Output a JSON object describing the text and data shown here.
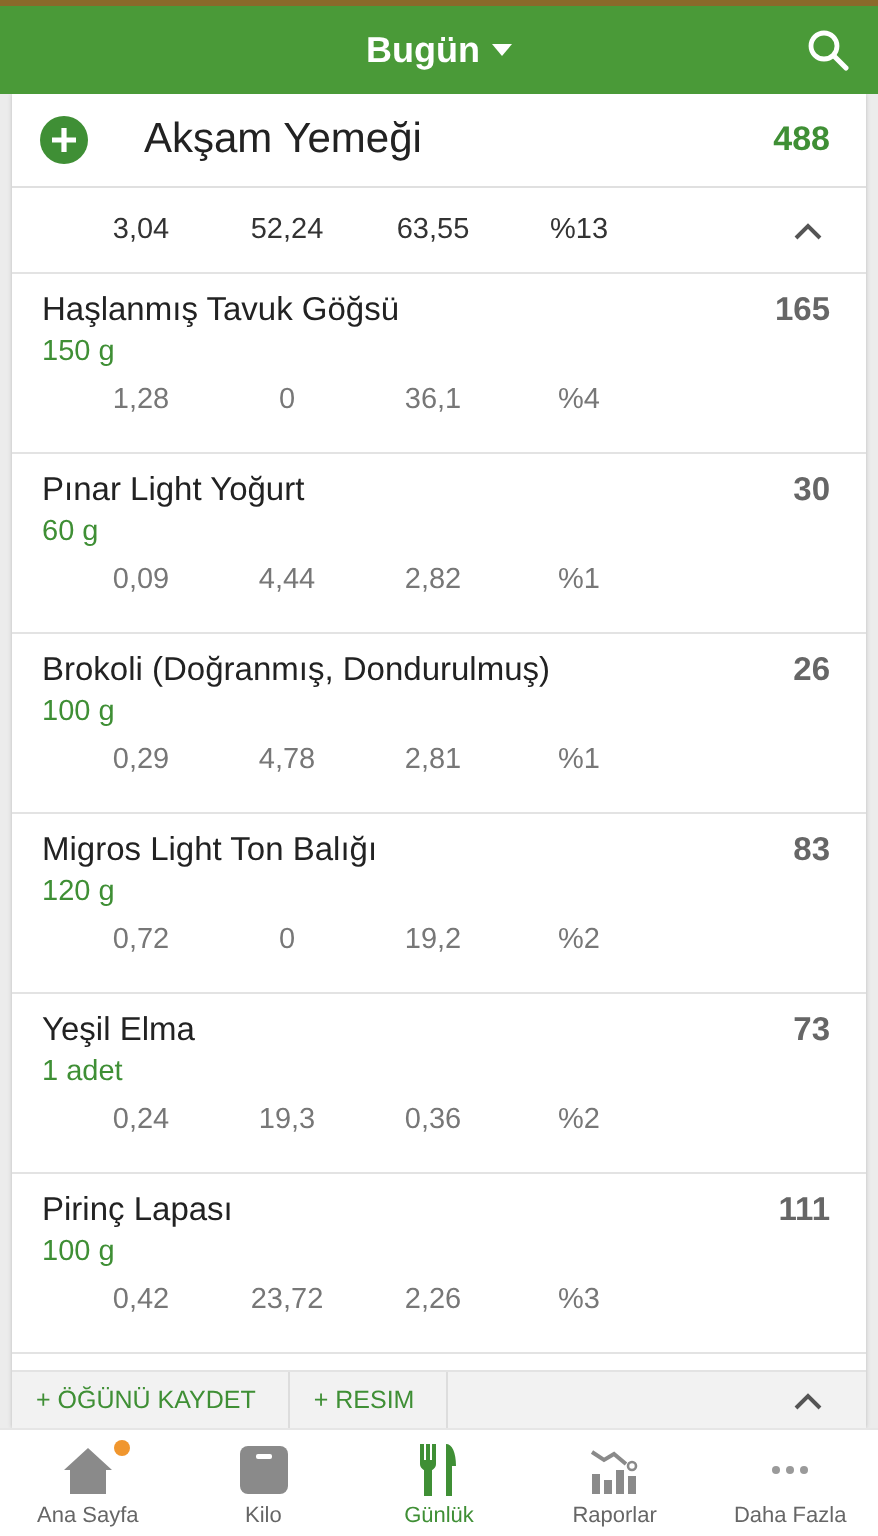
{
  "header": {
    "title": "Bugün"
  },
  "meal": {
    "name": "Akşam Yemeği",
    "calories": "488",
    "totals": [
      "3,04",
      "52,24",
      "63,55",
      "%13"
    ],
    "expanded": true
  },
  "foods": [
    {
      "name": "Haşlanmış Tavuk Göğsü",
      "amount": "150 g",
      "calories": "165",
      "macros": [
        "1,28",
        "0",
        "36,1",
        "%4"
      ]
    },
    {
      "name": "Pınar Light Yoğurt",
      "amount": "60 g",
      "calories": "30",
      "macros": [
        "0,09",
        "4,44",
        "2,82",
        "%1"
      ]
    },
    {
      "name": "Brokoli (Doğranmış, Dondurulmuş)",
      "amount": "100 g",
      "calories": "26",
      "macros": [
        "0,29",
        "4,78",
        "2,81",
        "%1"
      ]
    },
    {
      "name": "Migros Light Ton Balığı",
      "amount": "120 g",
      "calories": "83",
      "macros": [
        "0,72",
        "0",
        "19,2",
        "%2"
      ]
    },
    {
      "name": "Yeşil Elma",
      "amount": "1 adet",
      "calories": "73",
      "macros": [
        "0,24",
        "19,3",
        "0,36",
        "%2"
      ]
    },
    {
      "name": "Pirinç Lapası",
      "amount": "100 g",
      "calories": "111",
      "macros": [
        "0,42",
        "23,72",
        "2,26",
        "%3"
      ]
    }
  ],
  "footer_actions": [
    "+ ÖĞÜNÜ KAYDET",
    "+ RESIM"
  ],
  "tabs": [
    {
      "kind": "home",
      "label": "Ana Sayfa",
      "selected": false,
      "badge": true
    },
    {
      "kind": "scale",
      "label": "Kilo",
      "selected": false,
      "badge": false
    },
    {
      "kind": "diary",
      "label": "Günlük",
      "selected": true,
      "badge": false
    },
    {
      "kind": "reports",
      "label": "Raporlar",
      "selected": false,
      "badge": false
    },
    {
      "kind": "more",
      "label": "Daha Fazla",
      "selected": false,
      "badge": false
    }
  ]
}
